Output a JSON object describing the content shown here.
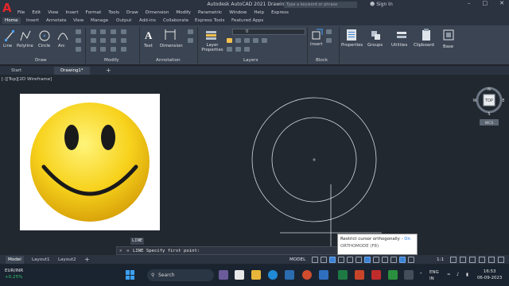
{
  "titlebar": {
    "title": "Autodesk AutoCAD 2021   Drawing1.dwg",
    "search_placeholder": "Type a keyword or phrase",
    "signin": "Sign In",
    "app_logo": "A"
  },
  "menu": [
    "File",
    "Edit",
    "View",
    "Insert",
    "Format",
    "Tools",
    "Draw",
    "Dimension",
    "Modify",
    "Parametric",
    "Window",
    "Help",
    "Express"
  ],
  "ribbon_tabs": [
    "Home",
    "Insert",
    "Annotate",
    "View",
    "Manage",
    "Output",
    "Add-ins",
    "Collaborate",
    "Express Tools",
    "Featured Apps"
  ],
  "active_ribbon_tab": "Home",
  "draw_tools": [
    "Line",
    "Polyline",
    "Circle",
    "Arc"
  ],
  "annotation_tools": [
    "Text",
    "Dimension"
  ],
  "layers": {
    "tool": "Layer Properties",
    "current_layer": "0"
  },
  "panel_labels": [
    "Draw",
    "Modify",
    "Annotation",
    "Layers",
    "Block"
  ],
  "right_tools": [
    "Insert",
    "Properties",
    "Groups",
    "Utilities",
    "Clipboard",
    "Base"
  ],
  "doc_tabs": [
    "Start",
    "Drawing1*"
  ],
  "view_label": "[-][Top][2D Wireframe]",
  "viewcube": {
    "top": "TOP",
    "n": "N",
    "s": "S",
    "w": "W",
    "e": "E",
    "wcs": "WCS"
  },
  "command": {
    "tooltip": "LINE",
    "prompt": "LINE Specify first point:"
  },
  "osnap_tooltip": {
    "line1": "Restrict cursor orthogonally - ",
    "state": "On",
    "line2": "ORTHOMODE (F8)"
  },
  "layout_tabs": [
    "Model",
    "Layout1",
    "Layout2"
  ],
  "status": {
    "model": "MODEL",
    "scale": "1:1"
  },
  "taskbar": {
    "ticker": "EUR/INR",
    "change": "+0.25%",
    "search": "Search",
    "lang1": "ENG",
    "lang2": "IN",
    "time": "16:53",
    "date": "06-09-2023"
  },
  "colors": {
    "accent": "#3c82d4",
    "canvas": "#212830",
    "smiley": "#f7d21c"
  }
}
